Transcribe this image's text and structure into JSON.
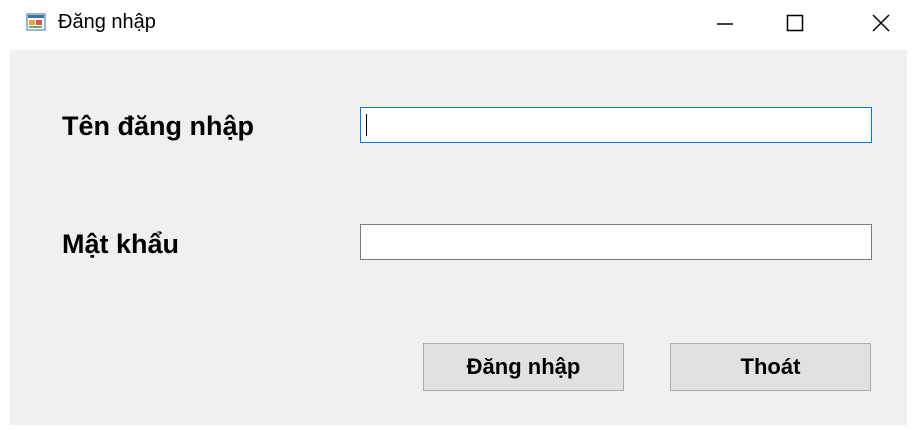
{
  "window": {
    "title": "Đăng nhập",
    "icon": "winforms-app-icon",
    "controls": {
      "minimize_icon": "minimize-icon",
      "maximize_icon": "maximize-icon",
      "close_icon": "close-icon"
    }
  },
  "form": {
    "username_label": "Tên đăng nhập",
    "username_value": "",
    "password_label": "Mật khẩu",
    "password_value": "",
    "login_button": "Đăng nhập",
    "exit_button": "Thoát"
  },
  "colors": {
    "client_background": "#f0f0f0",
    "focus_border": "#0078d7",
    "button_background": "#e1e1e1"
  }
}
